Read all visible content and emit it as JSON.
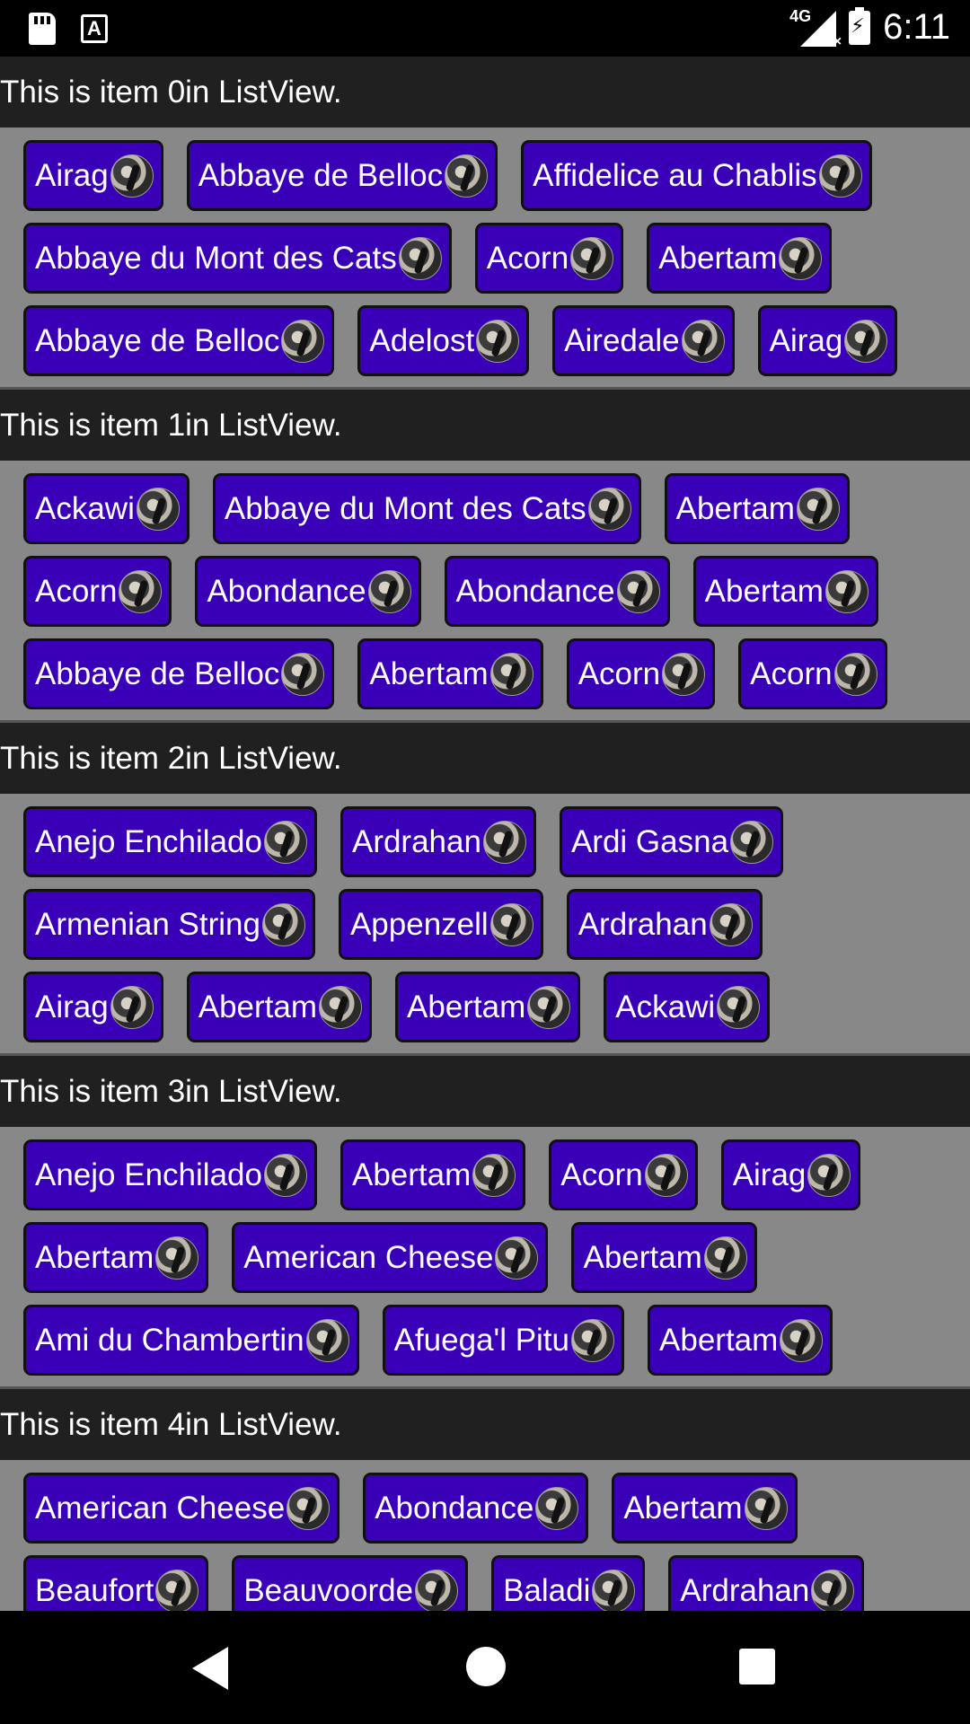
{
  "status_bar": {
    "time": "6:11",
    "network": "4G"
  },
  "list_items": [
    {
      "header": "This is item 0in ListView.",
      "rows": [
        [
          "Airag",
          "Abbaye de Belloc",
          "Affidelice au Chablis"
        ],
        [
          "Abbaye du Mont des Cats",
          "Acorn",
          "Abertam"
        ],
        [
          "Abbaye de Belloc",
          "Adelost",
          "Airedale",
          "Airag"
        ]
      ]
    },
    {
      "header": "This is item 1in ListView.",
      "rows": [
        [
          "Ackawi",
          "Abbaye du Mont des Cats",
          "Abertam"
        ],
        [
          "Acorn",
          "Abondance",
          "Abondance",
          "Abertam"
        ],
        [
          "Abbaye de Belloc",
          "Abertam",
          "Acorn",
          "Acorn"
        ]
      ]
    },
    {
      "header": "This is item 2in ListView.",
      "rows": [
        [
          "Anejo Enchilado",
          "Ardrahan",
          "Ardi Gasna"
        ],
        [
          "Armenian String",
          "Appenzell",
          "Ardrahan"
        ],
        [
          "Airag",
          "Abertam",
          "Abertam",
          "Ackawi"
        ]
      ]
    },
    {
      "header": "This is item 3in ListView.",
      "rows": [
        [
          "Anejo Enchilado",
          "Abertam",
          "Acorn",
          "Airag"
        ],
        [
          "Abertam",
          "American Cheese",
          "Abertam"
        ],
        [
          "Ami du Chambertin",
          "Afuega'l Pitu",
          "Abertam"
        ]
      ]
    },
    {
      "header": "This is item 4in ListView.",
      "rows": [
        [
          "American Cheese",
          "Abondance",
          "Abertam"
        ],
        [
          "Beaufort",
          "Beauvoorde",
          "Baladi",
          "Ardrahan"
        ]
      ]
    }
  ]
}
